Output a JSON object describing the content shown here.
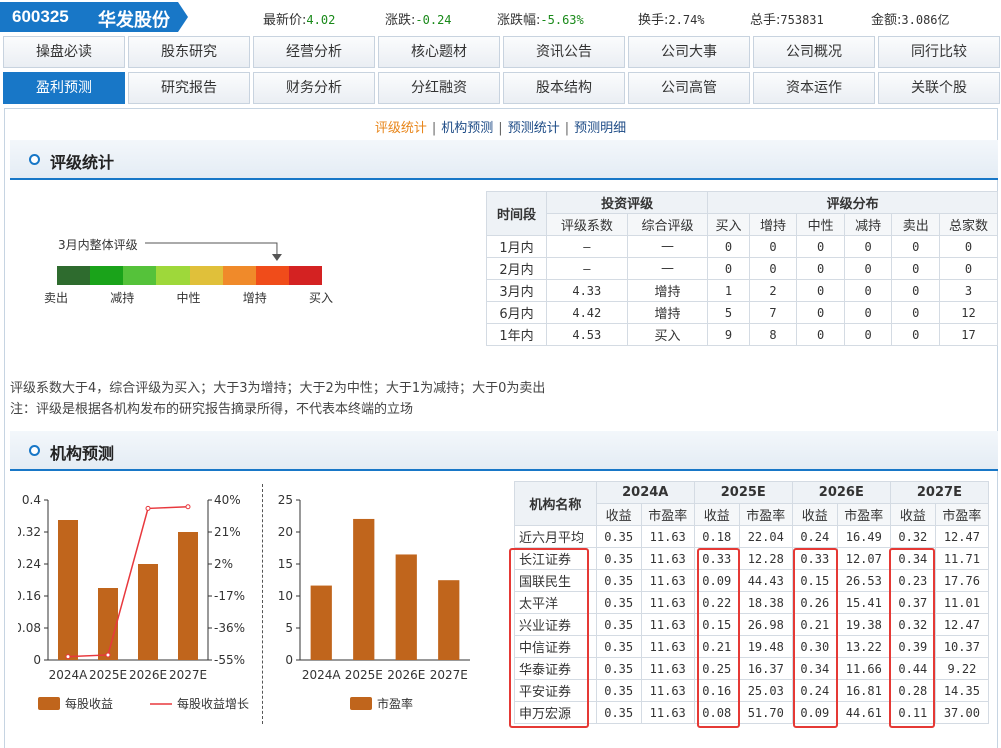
{
  "header": {
    "code": "600325",
    "name": "华发股份",
    "quotes": [
      {
        "label": "最新价:",
        "value": "4.02",
        "green": true
      },
      {
        "label": "涨跌:",
        "value": "-0.24",
        "green": true
      },
      {
        "label": "涨跌幅:",
        "value": "-5.63%",
        "green": true
      },
      {
        "label": "换手:",
        "value": "2.74%",
        "green": false
      },
      {
        "label": "总手:",
        "value": "753831",
        "green": false
      },
      {
        "label": "金额:",
        "value": "3.086亿",
        "green": false
      }
    ]
  },
  "nav": {
    "row1": [
      "操盘必读",
      "股东研究",
      "经营分析",
      "核心题材",
      "资讯公告",
      "公司大事",
      "公司概况",
      "同行比较"
    ],
    "row2": [
      "盈利预测",
      "研究报告",
      "财务分析",
      "分红融资",
      "股本结构",
      "公司高管",
      "资本运作",
      "关联个股"
    ],
    "active": "盈利预测"
  },
  "sublinks": [
    "评级统计",
    "机构预测",
    "预测统计",
    "预测明细"
  ],
  "rating": {
    "title": "评级统计",
    "gauge_label": "3月内整体评级",
    "gauge_colors": [
      "#2e6b2e",
      "#1aa31a",
      "#55c23a",
      "#9ed83a",
      "#e0c03a",
      "#f08a2a",
      "#f04c1a",
      "#d42222"
    ],
    "gauge_level": 0.83,
    "scale": [
      "卖出",
      "减持",
      "中性",
      "增持",
      "买入"
    ],
    "table": {
      "h_period": "时间段",
      "h_invest": "投资评级",
      "h_dist": "评级分布",
      "sub": [
        "评级系数",
        "综合评级",
        "买入",
        "增持",
        "中性",
        "减持",
        "卖出",
        "总家数"
      ],
      "rows": [
        [
          "1月内",
          "—",
          "—",
          "0",
          "0",
          "0",
          "0",
          "0",
          "0"
        ],
        [
          "2月内",
          "—",
          "—",
          "0",
          "0",
          "0",
          "0",
          "0",
          "0"
        ],
        [
          "3月内",
          "4.33",
          "增持",
          "1",
          "2",
          "0",
          "0",
          "0",
          "3"
        ],
        [
          "6月内",
          "4.42",
          "增持",
          "5",
          "7",
          "0",
          "0",
          "0",
          "12"
        ],
        [
          "1年内",
          "4.53",
          "买入",
          "9",
          "8",
          "0",
          "0",
          "0",
          "17"
        ]
      ]
    },
    "notes": [
      "评级系数大于4，综合评级为买入；大于3为增持；大于2为中性；大于1为减持；大于0为卖出",
      "注：评级是根据各机构发布的研究报告摘录所得，不代表本终端的立场"
    ]
  },
  "forecast": {
    "title": "机构预测",
    "table": {
      "h_name": "机构名称",
      "years": [
        "2024A",
        "2025E",
        "2026E",
        "2027E"
      ],
      "sub": [
        "收益",
        "市盈率"
      ],
      "rows": [
        [
          "近六月平均",
          "0.35",
          "11.63",
          "0.18",
          "22.04",
          "0.24",
          "16.49",
          "0.32",
          "12.47"
        ],
        [
          "长江证券",
          "0.35",
          "11.63",
          "0.33",
          "12.28",
          "0.33",
          "12.07",
          "0.34",
          "11.71"
        ],
        [
          "国联民生",
          "0.35",
          "11.63",
          "0.09",
          "44.43",
          "0.15",
          "26.53",
          "0.23",
          "17.76"
        ],
        [
          "太平洋",
          "0.35",
          "11.63",
          "0.22",
          "18.38",
          "0.26",
          "15.41",
          "0.37",
          "11.01"
        ],
        [
          "兴业证券",
          "0.35",
          "11.63",
          "0.15",
          "26.98",
          "0.21",
          "19.38",
          "0.32",
          "12.47"
        ],
        [
          "中信证券",
          "0.35",
          "11.63",
          "0.21",
          "19.48",
          "0.30",
          "13.22",
          "0.39",
          "10.37"
        ],
        [
          "华泰证券",
          "0.35",
          "11.63",
          "0.25",
          "16.37",
          "0.34",
          "11.66",
          "0.44",
          "9.22"
        ],
        [
          "平安证券",
          "0.35",
          "11.63",
          "0.16",
          "25.03",
          "0.24",
          "16.81",
          "0.28",
          "14.35"
        ],
        [
          "申万宏源",
          "0.35",
          "11.63",
          "0.08",
          "51.70",
          "0.09",
          "44.61",
          "0.11",
          "37.00"
        ]
      ]
    }
  },
  "chart_data": [
    {
      "type": "bar",
      "categories": [
        "2024A",
        "2025E",
        "2026E",
        "2027E"
      ],
      "series": [
        {
          "name": "每股收益",
          "type": "bar",
          "color": "#c0651c",
          "values": [
            0.35,
            0.18,
            0.24,
            0.32
          ]
        },
        {
          "name": "每股收益增长",
          "type": "line",
          "color": "#e8383d",
          "values": [
            -53,
            -52,
            35,
            36
          ]
        }
      ],
      "ylim": [
        0,
        0.4
      ],
      "yticks": [
        "0",
        "0.08",
        "0.16",
        "0.24",
        "0.32",
        "0.4"
      ],
      "y2lim": [
        -55,
        40
      ],
      "y2ticks": [
        "-55%",
        "-36%",
        "-17%",
        "2%",
        "21%",
        "40%"
      ]
    },
    {
      "type": "bar",
      "categories": [
        "2024A",
        "2025E",
        "2026E",
        "2027E"
      ],
      "series": [
        {
          "name": "市盈率",
          "color": "#c0651c",
          "values": [
            11.63,
            22.04,
            16.49,
            12.47
          ]
        }
      ],
      "ylim": [
        0,
        25
      ],
      "yticks": [
        "0",
        "5",
        "10",
        "15",
        "20",
        "25"
      ]
    }
  ]
}
